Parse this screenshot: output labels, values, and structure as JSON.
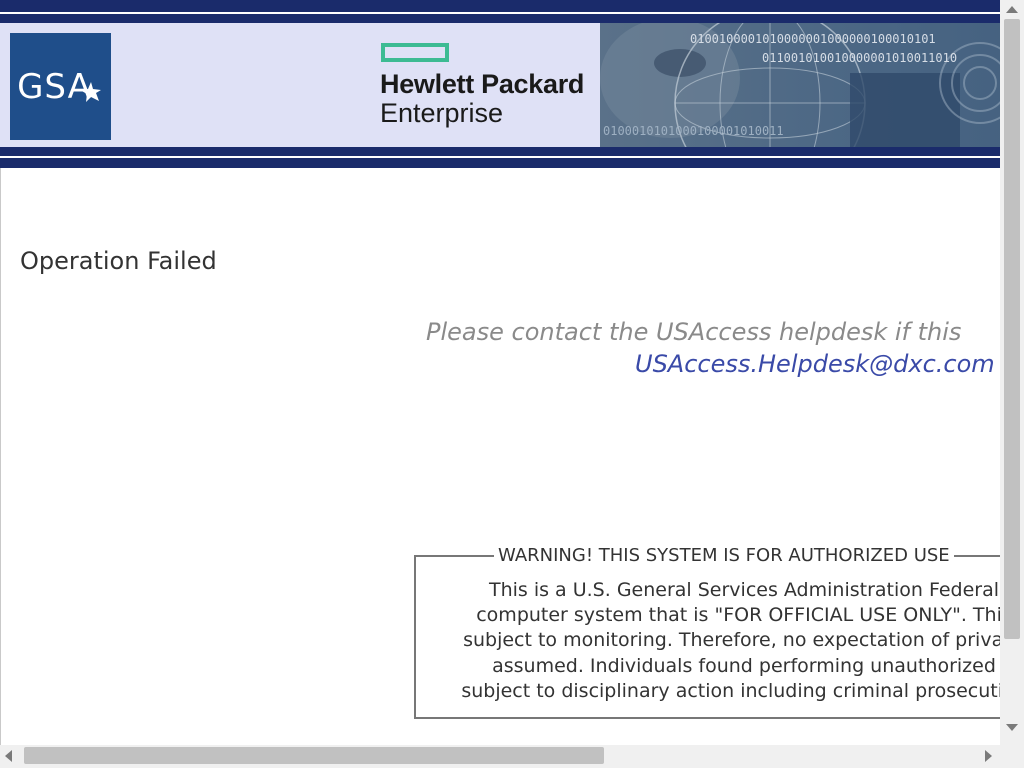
{
  "header": {
    "gsa_logo_text": "GSA",
    "hpe_line1": "Hewlett Packard",
    "hpe_line2": "Enterprise",
    "binary_line1": "0100100001010000001000000100010101",
    "binary_line2": "011001010010000001010011010",
    "binary_line3": "0100010101000100001010011",
    "colors": {
      "banner_navy": "#1a2b6b",
      "banner_bg": "#dfe1f6",
      "hpe_green": "#3dbb93",
      "gsa_blue": "#1f4e8a"
    }
  },
  "main": {
    "status_title": "Operation Failed",
    "contact_text": "Please contact the USAccess helpdesk if this",
    "contact_email": "USAccess.Helpdesk@dxc.com"
  },
  "warning": {
    "title": "WARNING! THIS SYSTEM IS FOR AUTHORIZED USE",
    "lines": [
      "This is a U.S. General Services Administration Federal",
      "computer system that is \"FOR OFFICIAL USE ONLY\". This",
      "subject to monitoring. Therefore, no expectation of privacy",
      "assumed. Individuals found performing unauthorized",
      "subject to disciplinary action including criminal prosecution"
    ]
  },
  "icons": {
    "scroll_up": "triangle-up-icon",
    "scroll_down": "triangle-down-icon",
    "scroll_left": "triangle-left-icon",
    "scroll_right": "triangle-right-icon"
  }
}
